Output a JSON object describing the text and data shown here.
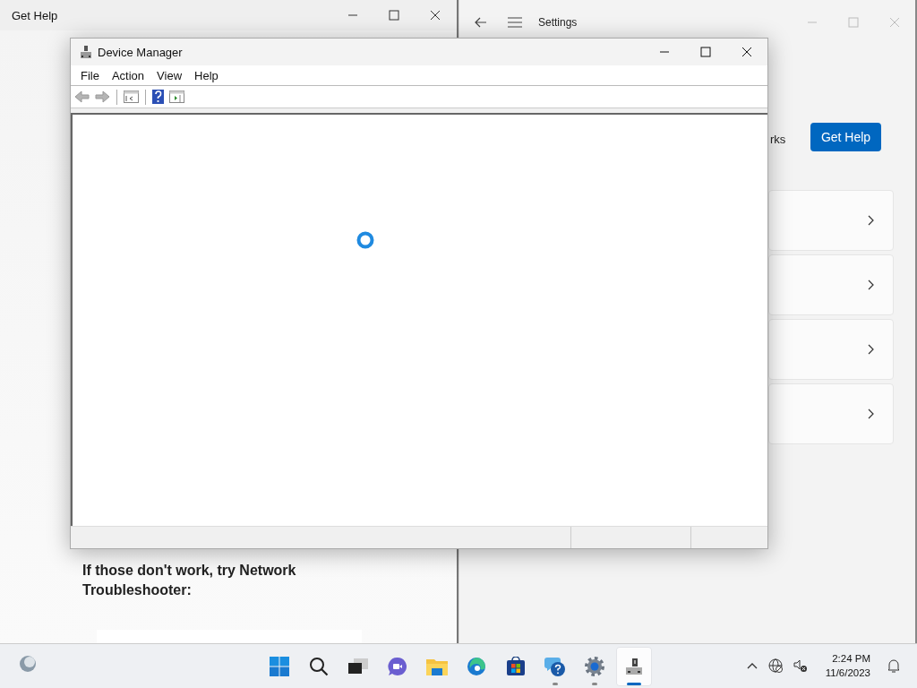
{
  "get_help_window": {
    "title": "Get Help",
    "body_text": "If those don't work, try Network Troubleshooter:"
  },
  "settings_window": {
    "title": "Settings",
    "partial_text": "rks",
    "help_button": "Get Help",
    "cards": [
      {
        "kind": "link-card"
      },
      {
        "kind": "link-card"
      },
      {
        "kind": "link-card"
      },
      {
        "kind": "link-card"
      }
    ]
  },
  "device_manager": {
    "title": "Device Manager",
    "menu": [
      "File",
      "Action",
      "View",
      "Help"
    ],
    "toolbar": [
      {
        "kind": "back",
        "disabled": true
      },
      {
        "kind": "forward",
        "disabled": true
      },
      {
        "kind": "separator"
      },
      {
        "kind": "console-tree",
        "disabled": false
      },
      {
        "kind": "separator"
      },
      {
        "kind": "help",
        "disabled": false
      },
      {
        "kind": "action-pane",
        "disabled": false
      }
    ],
    "loading": true
  },
  "taskbar": {
    "apps": [
      {
        "kind": "start",
        "running": false,
        "active": false
      },
      {
        "kind": "search",
        "running": false,
        "active": false
      },
      {
        "kind": "task-view",
        "running": false,
        "active": false
      },
      {
        "kind": "chat",
        "running": false,
        "active": false
      },
      {
        "kind": "explorer",
        "running": false,
        "active": false
      },
      {
        "kind": "edge",
        "running": false,
        "active": false
      },
      {
        "kind": "store",
        "running": false,
        "active": false
      },
      {
        "kind": "get-help",
        "running": true,
        "active": false
      },
      {
        "kind": "settings",
        "running": true,
        "active": false
      },
      {
        "kind": "device-manager",
        "running": true,
        "active": true
      }
    ],
    "time": "2:24 PM",
    "date": "11/6/2023"
  }
}
